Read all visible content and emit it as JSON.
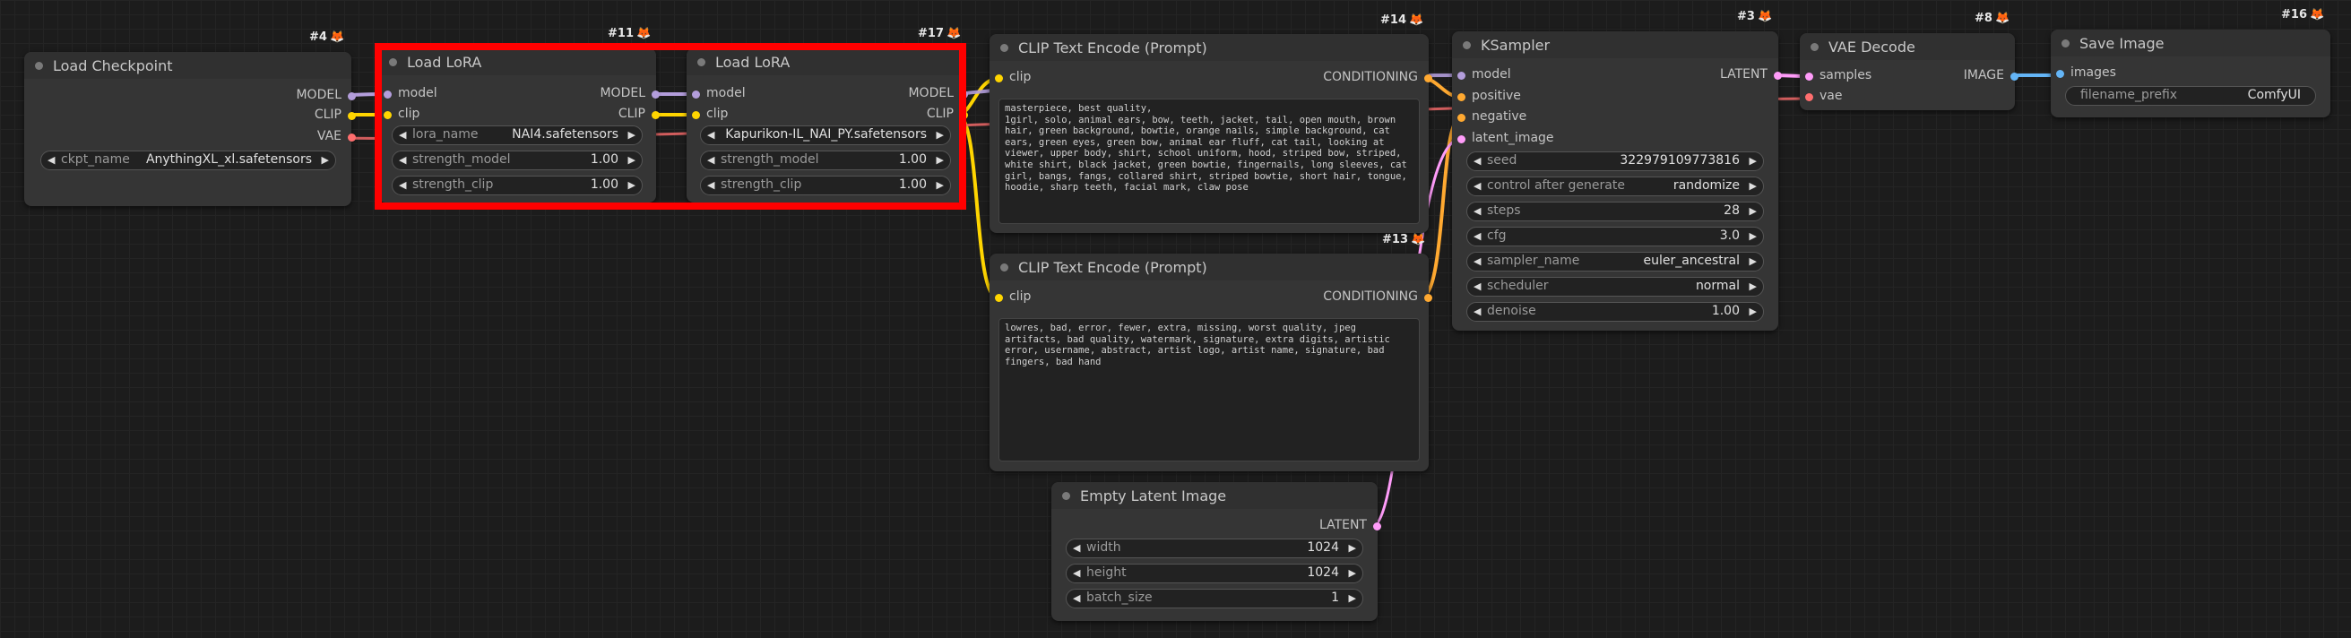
{
  "colors": {
    "model": "#b39ddb",
    "clip": "#ffd500",
    "vae": "#ff6e6e",
    "conditioning": "#ffa931",
    "latent": "#ff9cf9",
    "image": "#64b5f6",
    "highlight": "#ff0000"
  },
  "nodes": {
    "load_checkpoint": {
      "badge": "#4",
      "title": "Load Checkpoint",
      "outputs": [
        "MODEL",
        "CLIP",
        "VAE"
      ],
      "widgets": [
        {
          "label": "ckpt_name",
          "value": "AnythingXL_xl.safetensors"
        }
      ]
    },
    "load_lora_1": {
      "badge": "#11",
      "title": "Load LoRA",
      "inputs": [
        "model",
        "clip"
      ],
      "outputs": [
        "MODEL",
        "CLIP"
      ],
      "widgets": [
        {
          "label": "lora_name",
          "value": "NAI4.safetensors"
        },
        {
          "label": "strength_model",
          "value": "1.00"
        },
        {
          "label": "strength_clip",
          "value": "1.00"
        }
      ]
    },
    "load_lora_2": {
      "badge": "#17",
      "title": "Load LoRA",
      "inputs": [
        "model",
        "clip"
      ],
      "outputs": [
        "MODEL",
        "CLIP"
      ],
      "widgets": [
        {
          "label": "",
          "value": "Kapurikon-IL_NAI_PY.safetensors"
        },
        {
          "label": "strength_model",
          "value": "1.00"
        },
        {
          "label": "strength_clip",
          "value": "1.00"
        }
      ]
    },
    "clip_text_encode_pos": {
      "badge": "#14",
      "title": "CLIP Text Encode (Prompt)",
      "inputs": [
        "clip"
      ],
      "outputs": [
        "CONDITIONING"
      ],
      "text": "masterpiece, best quality,\n1girl, solo, animal ears, bow, teeth, jacket, tail, open mouth, brown hair, green background, bowtie, orange nails, simple background, cat ears, green eyes, green bow, animal ear fluff, cat tail, looking at viewer, upper body, shirt, school uniform, hood, striped bow, striped, white shirt, black jacket, green bowtie, fingernails, long sleeves, cat girl, bangs, fangs, collared shirt, striped bowtie, short hair, tongue, hoodie, sharp teeth, facial mark, claw pose"
    },
    "clip_text_encode_neg": {
      "badge": "#13",
      "title": "CLIP Text Encode (Prompt)",
      "inputs": [
        "clip"
      ],
      "outputs": [
        "CONDITIONING"
      ],
      "text": "lowres, bad, error, fewer, extra, missing, worst quality, jpeg artifacts, bad quality, watermark, signature, extra digits, artistic error, username, abstract, artist logo, artist name, signature, bad fingers, bad hand"
    },
    "ksampler": {
      "badge": "#3",
      "title": "KSampler",
      "inputs": [
        "model",
        "positive",
        "negative",
        "latent_image"
      ],
      "outputs": [
        "LATENT"
      ],
      "widgets": [
        {
          "label": "seed",
          "value": "322979109773816"
        },
        {
          "label": "control after generate",
          "value": "randomize"
        },
        {
          "label": "steps",
          "value": "28"
        },
        {
          "label": "cfg",
          "value": "3.0"
        },
        {
          "label": "sampler_name",
          "value": "euler_ancestral"
        },
        {
          "label": "scheduler",
          "value": "normal"
        },
        {
          "label": "denoise",
          "value": "1.00"
        }
      ]
    },
    "vae_decode": {
      "badge": "#8",
      "title": "VAE Decode",
      "inputs": [
        "samples",
        "vae"
      ],
      "outputs": [
        "IMAGE"
      ]
    },
    "save_image": {
      "badge": "#16",
      "title": "Save Image",
      "inputs": [
        "images"
      ],
      "widgets": [
        {
          "label": "filename_prefix",
          "value": "ComfyUI"
        }
      ]
    },
    "empty_latent": {
      "title": "Empty Latent Image",
      "outputs": [
        "LATENT"
      ],
      "widgets": [
        {
          "label": "width",
          "value": "1024"
        },
        {
          "label": "height",
          "value": "1024"
        },
        {
          "label": "batch_size",
          "value": "1"
        }
      ]
    }
  }
}
